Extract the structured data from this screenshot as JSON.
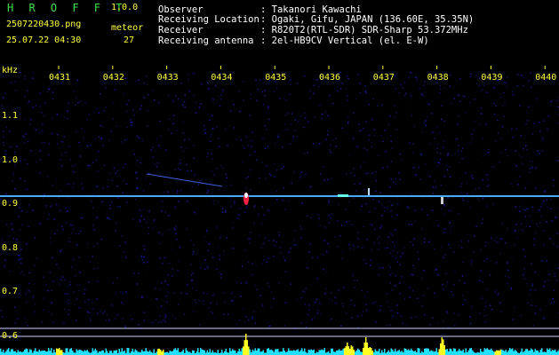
{
  "header": {
    "app_name": "H R O F F T",
    "version": "1.0.0",
    "filename": "2507220430.png",
    "datetime": "25.07.22 04:30",
    "meteor_label": "meteor",
    "meteor_count": "27",
    "info_labels": [
      "Observer",
      "Receiving Location",
      "Receiver",
      "Receiving antenna"
    ],
    "info_values": [
      ": Takanori Kawachi",
      ": Ogaki, Gifu, JAPAN (136.60E, 35.35N)",
      ": R820T2(RTL-SDR) SDR-Sharp 53.372MHz",
      ": 2el-HB9CV Vertical (el. E-W)"
    ]
  },
  "spectrogram": {
    "unit_label": "kHz",
    "time_labels": [
      "0431",
      "0432",
      "0433",
      "0434",
      "0435",
      "0436",
      "0437",
      "0438",
      "0439",
      "0440"
    ],
    "freq_labels": [
      "1.1",
      "1.0",
      "0.9",
      "0.8",
      "0.7",
      "0.6"
    ],
    "colors": {
      "background": "#000000",
      "noise": "#1a1aa0",
      "carrier": "#4aa8ff",
      "echo_hot": "#ff2040",
      "echo_warm": "#ffffff",
      "histogram": "#22e0ff",
      "histogram_peak": "#ffff22",
      "axis_text": "#ffff3a",
      "grid": "#ffffff"
    }
  }
}
